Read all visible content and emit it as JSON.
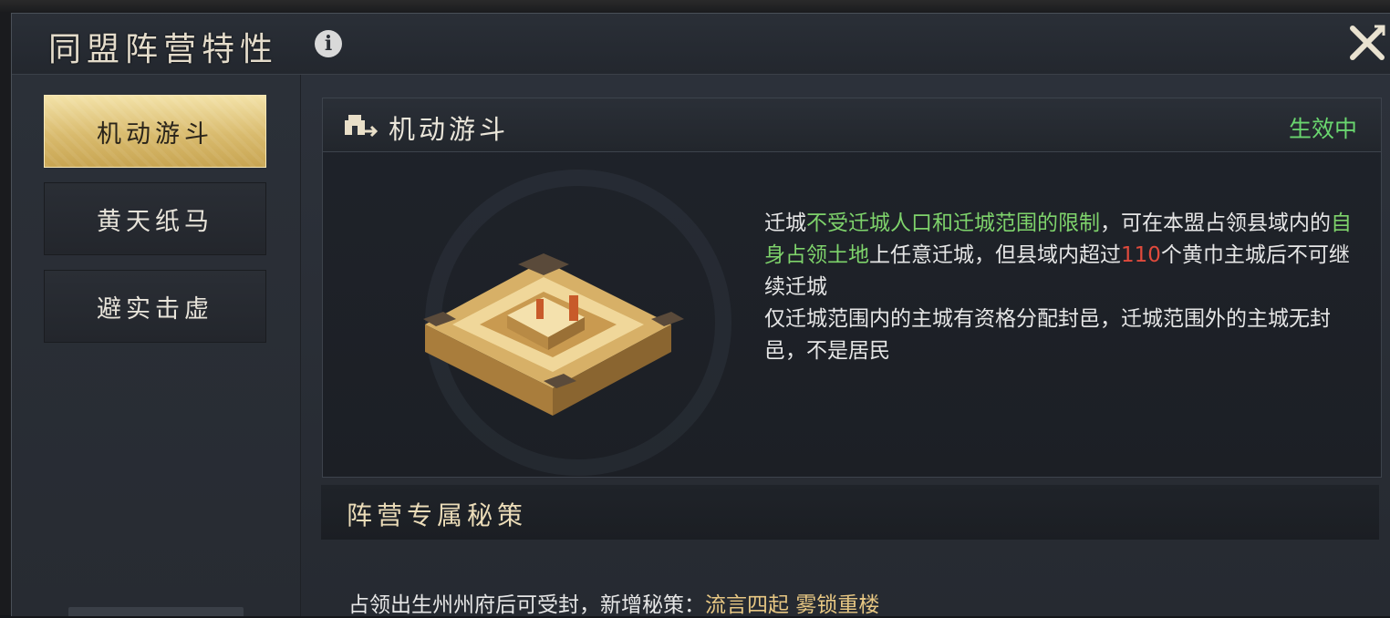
{
  "window": {
    "title": "同盟阵营特性",
    "info_icon": "info-icon",
    "close_icon": "close-icon"
  },
  "sidebar": {
    "items": [
      {
        "label": "机动游斗",
        "active": true
      },
      {
        "label": "黄天纸马",
        "active": false
      },
      {
        "label": "避实击虚",
        "active": false
      }
    ]
  },
  "detail": {
    "icon": "city-move-icon",
    "title": "机动游斗",
    "status": "生效中",
    "desc": {
      "p1_a": "迁城",
      "p1_b": "不受迁城人口和迁城范围的限制",
      "p1_c": "，可在本盟占领县域内的",
      "p1_d": "自身占领土地",
      "p1_e": "上任意迁城，但县域内超过",
      "p1_f": "110",
      "p1_g": "个黄巾主城后不可继续迁城",
      "p2": "仅迁城范围内的主城有资格分配封邑，迁城范围外的主城无封邑，不是居民"
    }
  },
  "secret_section": {
    "title": "阵营专属秘策",
    "line_prefix": "占领出生州州府后可受封，新增秘策：",
    "strategy_1": "流言四起",
    "strategy_2": "雾锁重楼"
  },
  "colors": {
    "status_green": "#6ad66f",
    "highlight_green": "#7ed36b",
    "highlight_red": "#e04a3c",
    "gold_tab": "#d9bb6e",
    "strategy_gold": "#e7c783"
  }
}
